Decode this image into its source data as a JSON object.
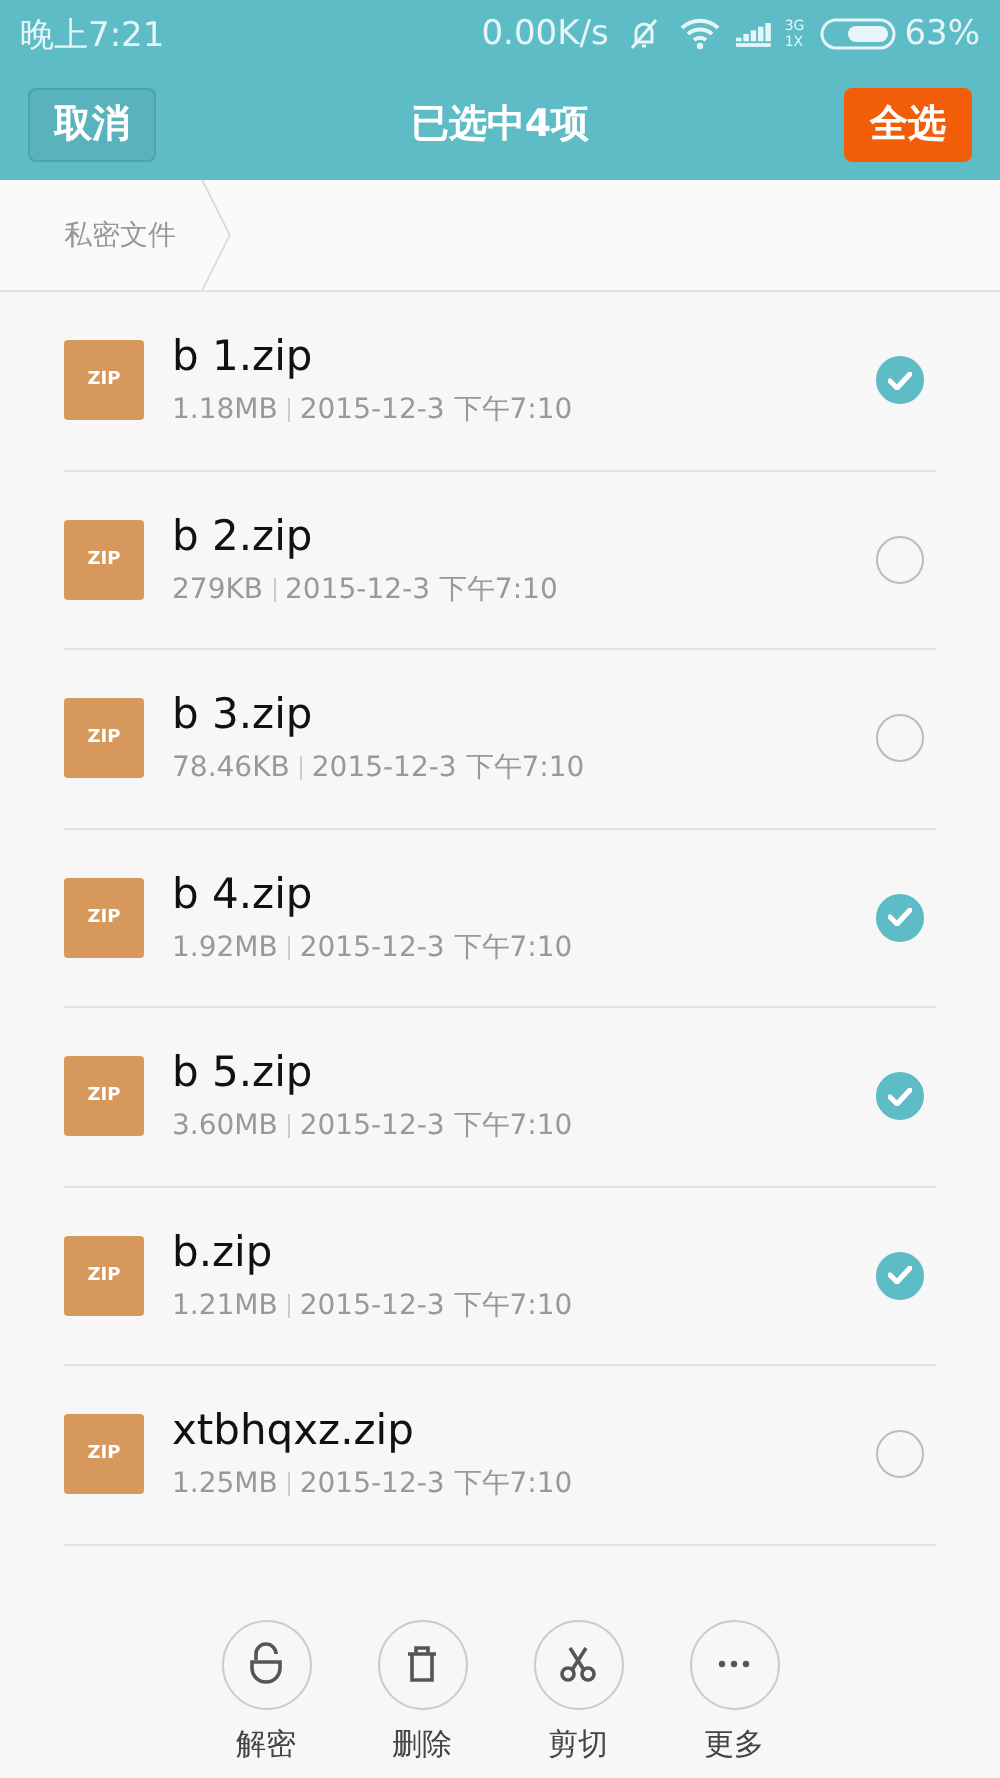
{
  "status_bar": {
    "time": "晚上7:21",
    "speed": "0.00K/s",
    "network_top": "3G",
    "network_bottom": "1X",
    "battery": "63%"
  },
  "header": {
    "cancel": "取消",
    "title": "已选中4项",
    "select_all": "全选"
  },
  "breadcrumb": [
    "私密文件"
  ],
  "files": [
    {
      "name": "b 1.zip",
      "type": "ZIP",
      "size": "1.18MB",
      "date": "2015-12-3 下午7:10",
      "selected": true
    },
    {
      "name": "b 2.zip",
      "type": "ZIP",
      "size": "279KB",
      "date": "2015-12-3 下午7:10",
      "selected": false
    },
    {
      "name": "b 3.zip",
      "type": "ZIP",
      "size": "78.46KB",
      "date": "2015-12-3 下午7:10",
      "selected": false
    },
    {
      "name": "b 4.zip",
      "type": "ZIP",
      "size": "1.92MB",
      "date": "2015-12-3 下午7:10",
      "selected": true
    },
    {
      "name": "b 5.zip",
      "type": "ZIP",
      "size": "3.60MB",
      "date": "2015-12-3 下午7:10",
      "selected": true
    },
    {
      "name": "b.zip",
      "type": "ZIP",
      "size": "1.21MB",
      "date": "2015-12-3 下午7:10",
      "selected": true
    },
    {
      "name": "xtbhqxz.zip",
      "type": "ZIP",
      "size": "1.25MB",
      "date": "2015-12-3 下午7:10",
      "selected": false
    }
  ],
  "actions": [
    {
      "kind": "unlock",
      "label": "解密"
    },
    {
      "kind": "delete",
      "label": "删除"
    },
    {
      "kind": "cut",
      "label": "剪切"
    },
    {
      "kind": "more",
      "label": "更多"
    }
  ]
}
